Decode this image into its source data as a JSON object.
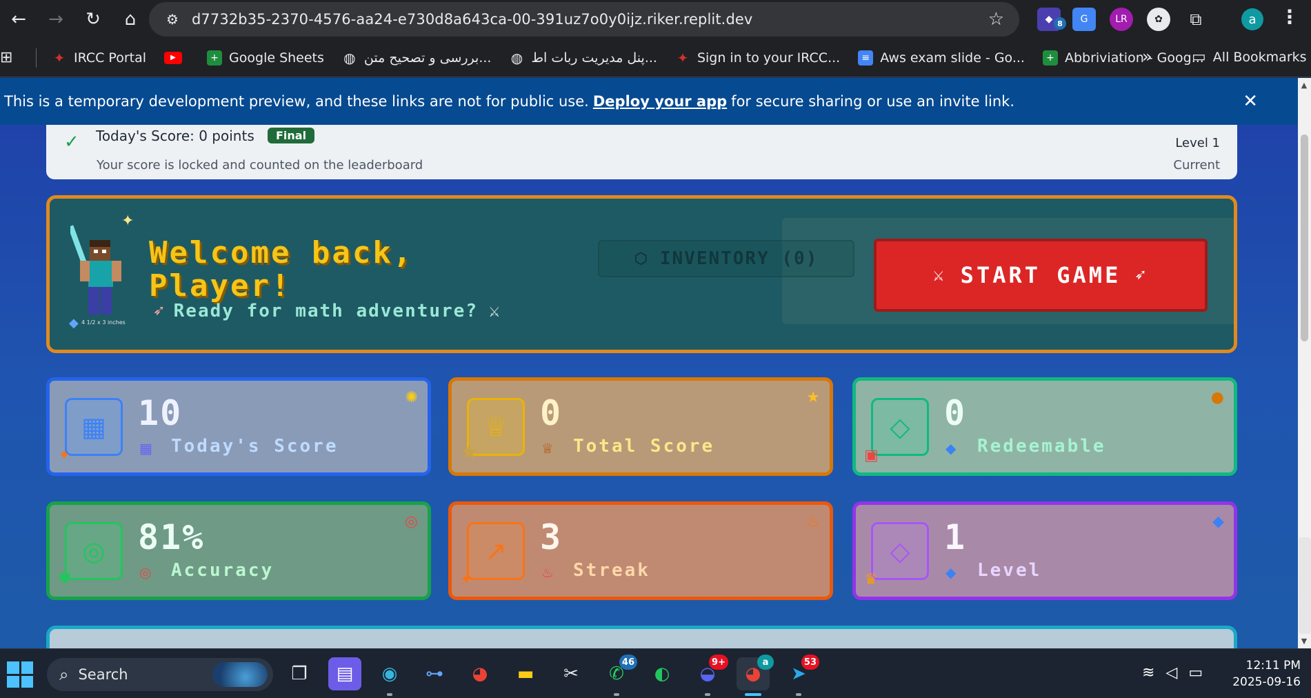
{
  "browser": {
    "url": "d7732b35-2370-4576-aa24-e730d8a643ca-00-391uz7o0y0ijz.riker.replit.dev",
    "profile_initial": "a",
    "ext_badge": "8"
  },
  "bookmarks": {
    "items": [
      {
        "label": "IRCC Portal",
        "icon": "maple-leaf-icon",
        "color": "#d32f2f"
      },
      {
        "label": "",
        "icon": "youtube-icon",
        "color": "#ff0000"
      },
      {
        "label": "Google Sheets",
        "icon": "sheets-icon",
        "color": "#1e8e3e"
      },
      {
        "label": "بررسی و تصحیح متن...",
        "icon": "globe-icon",
        "color": "#5f6368"
      },
      {
        "label": "پنل مدیریت ربات اط...",
        "icon": "globe-icon",
        "color": "#5f6368"
      },
      {
        "label": "Sign in to your IRCC...",
        "icon": "maple-leaf-icon",
        "color": "#d32f2f"
      },
      {
        "label": "Aws exam slide - Go...",
        "icon": "docs-icon",
        "color": "#4285f4"
      },
      {
        "label": "Abbriviation - Goog...",
        "icon": "sheets-icon",
        "color": "#1e8e3e"
      }
    ],
    "more": "»",
    "all_bookmarks": "All Bookmarks"
  },
  "banner": {
    "text_before": "This is a temporary development preview, and these links are not for public use.",
    "link": "Deploy your app",
    "text_after": "for secure sharing or use an invite link."
  },
  "score_card": {
    "title": "Today's Score: 0 points",
    "pill": "Final",
    "sub": "Your score is locked and counted on the leaderboard",
    "level": "Level 1",
    "current": "Current"
  },
  "welcome": {
    "title": "Welcome back, Player!",
    "subtitle": "Ready for math adventure?",
    "avatar_caption": "4 1/2 x 3 inches",
    "inventory": "INVENTORY (0)",
    "start": "START GAME"
  },
  "stats": [
    {
      "value": "10",
      "label": "Today's Score",
      "mini": "calendar-icon",
      "color": "#2563eb"
    },
    {
      "value": "0",
      "label": "Total Score",
      "mini": "trophy-icon",
      "color": "#d97706"
    },
    {
      "value": "0",
      "label": "Redeemable",
      "mini": "gem-icon",
      "color": "#10b981"
    },
    {
      "value": "81%",
      "label": "Accuracy",
      "mini": "target-icon",
      "color": "#16a34a"
    },
    {
      "value": "3",
      "label": "Streak",
      "mini": "fire-icon",
      "color": "#ea580c"
    },
    {
      "value": "1",
      "label": "Level",
      "mini": "gem-icon",
      "color": "#9333ea"
    }
  ],
  "taskbar": {
    "search": "Search",
    "whatsapp_badge": "46",
    "discord_badge": "9+",
    "telegram_badge": "53",
    "chrome_badge": "a",
    "time": "12:11 PM",
    "date": "2025-09-16"
  }
}
